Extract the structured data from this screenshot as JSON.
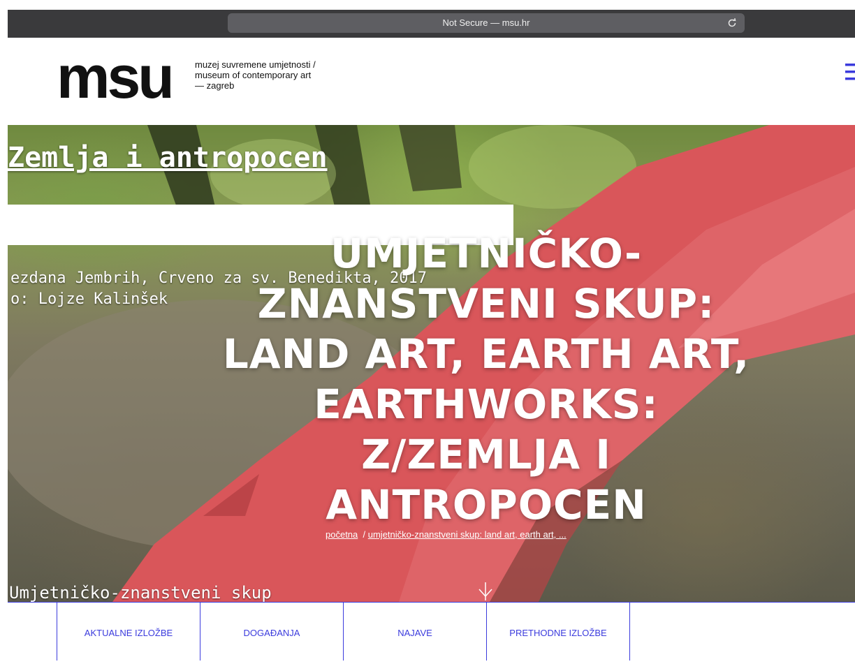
{
  "browser": {
    "url_text": "Not Secure — msu.hr"
  },
  "header": {
    "logo": "msu",
    "subtitle_lines": [
      "muzej suvremene umjetnosti /",
      "museum of contemporary art",
      "— zagreb"
    ]
  },
  "hero": {
    "overlay_title": "Zemlja i antropocen",
    "caption_lines": [
      "ezdana Jembrih, Crveno za sv. Benedikta, 2017",
      "o: Lojze Kalinšek"
    ],
    "heading_lines": [
      "UMJETNIČKO-",
      "ZNANSTVENI SKUP:",
      "LAND ART, EARTH ART,",
      "EARTHWORKS:",
      "Z/ZEMLJA I",
      "ANTROPOCEN"
    ],
    "breadcrumb": {
      "home": "početna",
      "separator": "/",
      "current": "umjetničko-znanstveni skup: land art, earth art, ..."
    },
    "bottom_text": "Umjetničko-znanstveni skup"
  },
  "nav": {
    "items": [
      "AKTUALNE IZLOŽBE",
      "DOGAĐANJA",
      "NAJAVE",
      "PRETHODNE IZLOŽBE"
    ]
  },
  "colors": {
    "accent": "#3b3bdd",
    "browser_bar": "#3a3a3c",
    "fabric_red": "#d9565a"
  }
}
